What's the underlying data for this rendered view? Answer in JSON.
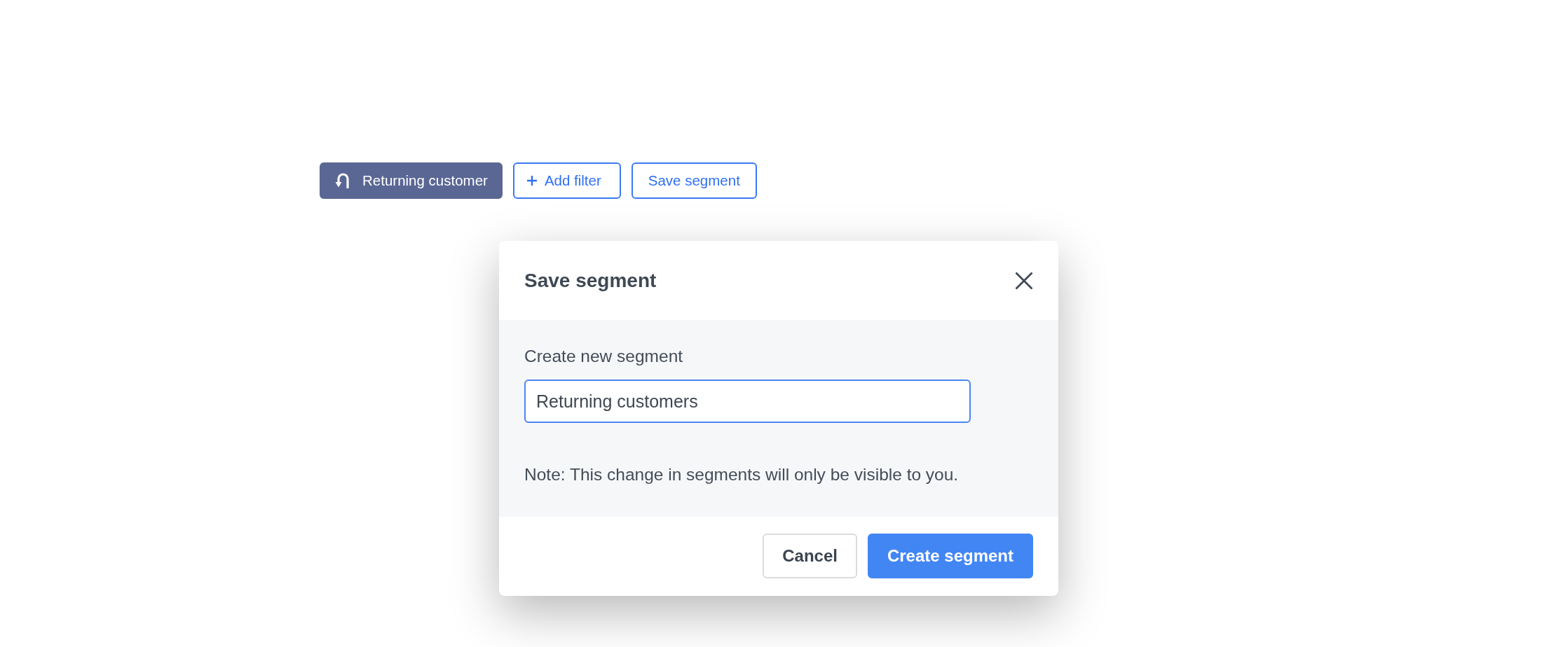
{
  "toolbar": {
    "segment_chip": {
      "label": "Returning customer"
    },
    "buttons": [
      {
        "kind": "add",
        "label": "Add filter"
      },
      {
        "kind": "plain",
        "label": "Save segment"
      }
    ]
  },
  "dialog": {
    "title": "Save segment",
    "field": {
      "label": "Create new segment",
      "value": "Returning customers"
    },
    "note": "Note: This change in segments will only be visible to you.",
    "buttons": [
      {
        "kind": "secondary",
        "label": "Cancel"
      },
      {
        "kind": "primary",
        "label": "Create segment"
      }
    ]
  }
}
